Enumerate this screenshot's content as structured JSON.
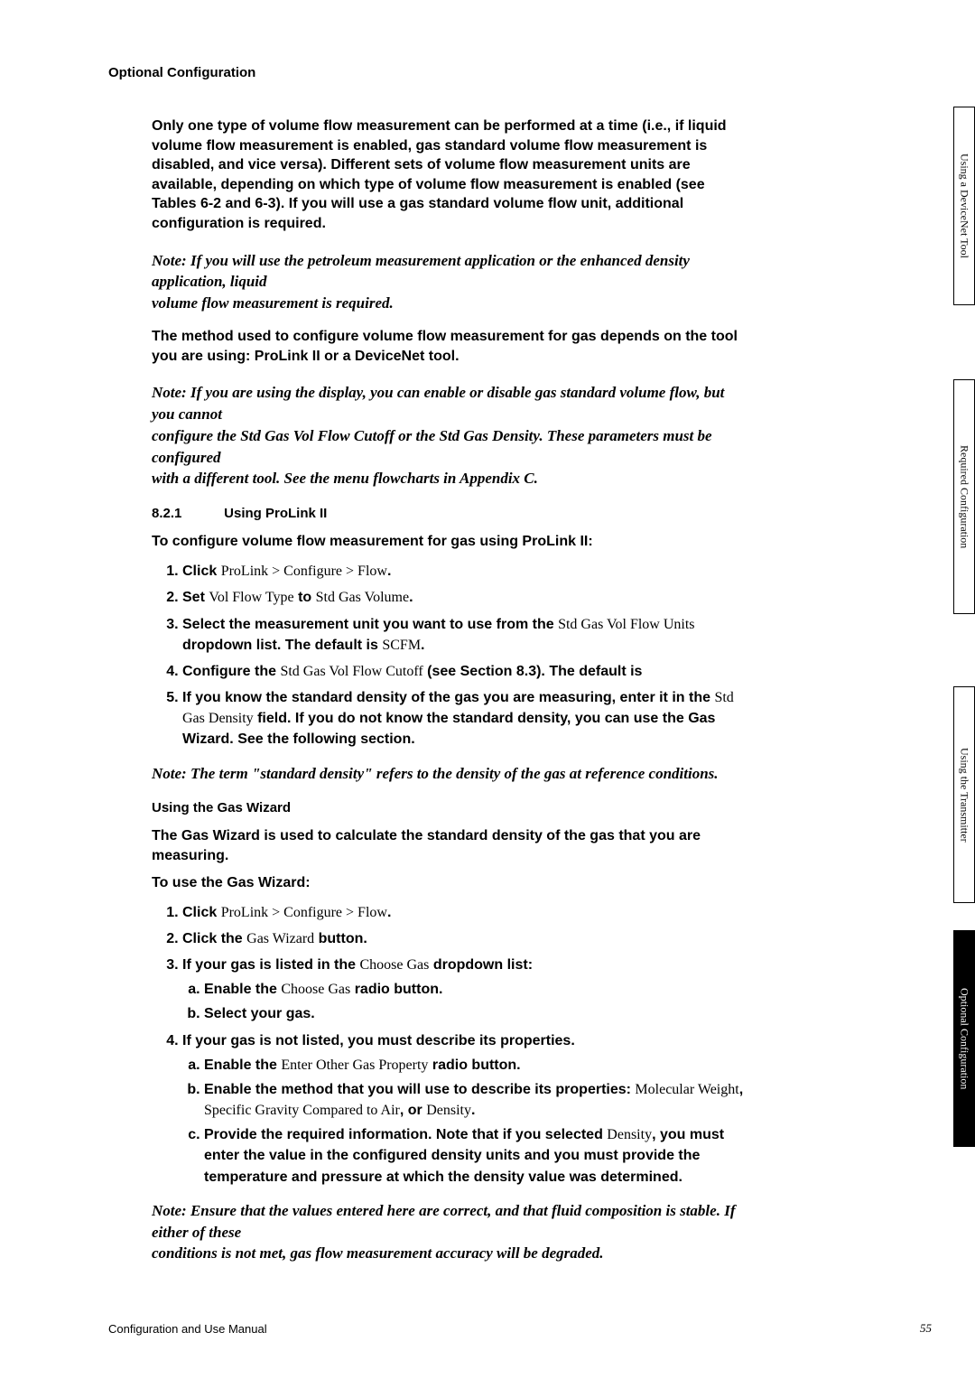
{
  "header": "Optional Configuration",
  "intro_para": "Only one type of volume flow measurement can be performed at a time (i.e., if liquid volume flow measurement is enabled, gas standard volume flow measurement is disabled, and vice versa). Different sets of volume flow measurement units are available, depending on which type of volume flow measurement is enabled (see Tables 6-2 and 6-3). If you will use a gas standard volume flow unit, additional configuration is required.",
  "para2": "The method used to configure volume flow measurement for gas depends on the tool you are using: ProLink II or a DeviceNet tool.",
  "sec_num": "8.2.1",
  "sec_title": "Using ProLink II",
  "lead1": "To configure volume flow measurement for gas using ProLink II:",
  "steps1": {
    "s1a": "Click ",
    "s1b": "ProLink > Configure > Flow",
    "s1c": ".",
    "s2a": "Set ",
    "s2b": "Vol Flow Type",
    "s2c": " to ",
    "s2d": "Std Gas Volume",
    "s2e": ".",
    "s3a": "Select the measurement unit you want to use from the ",
    "s3b": "Std Gas Vol Flow Units",
    "s3c": " dropdown list. The default is ",
    "s3d": "SCFM",
    "s3e": ".",
    "s4a": "Configure the ",
    "s4b": "Std Gas Vol Flow Cutoff",
    "s4c": " (see Section 8.3). The default is",
    "s5a": "If you know the standard density of the gas you are measuring, enter it in the ",
    "s5b": "Std Gas Density",
    "s5c": " field. If you do not know the standard density, you can use the Gas Wizard. See the following section."
  },
  "block_title": "Using the Gas Wizard",
  "gw_para": "The Gas Wizard is used to calculate the standard density of the gas that you are measuring.",
  "lead2": "To use the Gas Wizard:",
  "steps2": {
    "s1a": "Click ",
    "s1b": "ProLink > Configure > Flow",
    "s1c": ".",
    "s2a": "Click the ",
    "s2b": "Gas Wizard",
    "s2c": " button.",
    "s3a": "If your gas is listed in the ",
    "s3b": "Choose Gas",
    "s3c": " dropdown list:",
    "s3_a_a": "Enable the ",
    "s3_a_b": "Choose Gas",
    "s3_a_c": " radio button.",
    "s3_b": "Select your gas.",
    "s4": "If your gas is not listed, you must describe its properties.",
    "s4_a_a": "Enable the ",
    "s4_a_b": "Enter Other Gas Property",
    "s4_a_c": " radio button.",
    "s4_b_a": "Enable the method that you will use to describe its properties: ",
    "s4_b_b": "Molecular Weight",
    "s4_b_c": ", ",
    "s4_b_d": "Specific Gravity Compared to Air",
    "s4_b_e": ", or ",
    "s4_b_f": "Density",
    "s4_b_g": ".",
    "s4_c_a": "Provide the required information. Note that if you selected ",
    "s4_c_b": "Density",
    "s4_c_c": ", you must enter the value in the configured density units and you must provide the temperature and pressure at which the density value was determined."
  },
  "glyph_rows": {
    "gA": [
      "Note: If you will use the petroleum measurement application or the enhanced density application, liquid",
      "volume flow measurement is required."
    ],
    "gB": [
      "Note: If you are using the display, you can enable or disable gas standard volume flow, but you cannot",
      "configure the Std Gas Vol Flow Cutoff or the Std Gas Density. These parameters must be configured",
      "with a different tool. See the menu flowcharts in Appendix C."
    ],
    "gC": [
      "Note: The term \"standard density\" refers to the density of the gas at reference conditions."
    ],
    "gD": [
      "Note: Ensure that the values entered here are correct, and that fluid composition is stable. If either of these",
      "conditions is not met, gas flow measurement accuracy will be degraded."
    ]
  },
  "tabs": {
    "t1": "Using a DeviceNet Tool",
    "t2": "Required Configuration",
    "t3": "Using the Transmitter",
    "t4": "Optional Configuration"
  },
  "footer_left": "Configuration and Use Manual",
  "footer_pg": "55"
}
